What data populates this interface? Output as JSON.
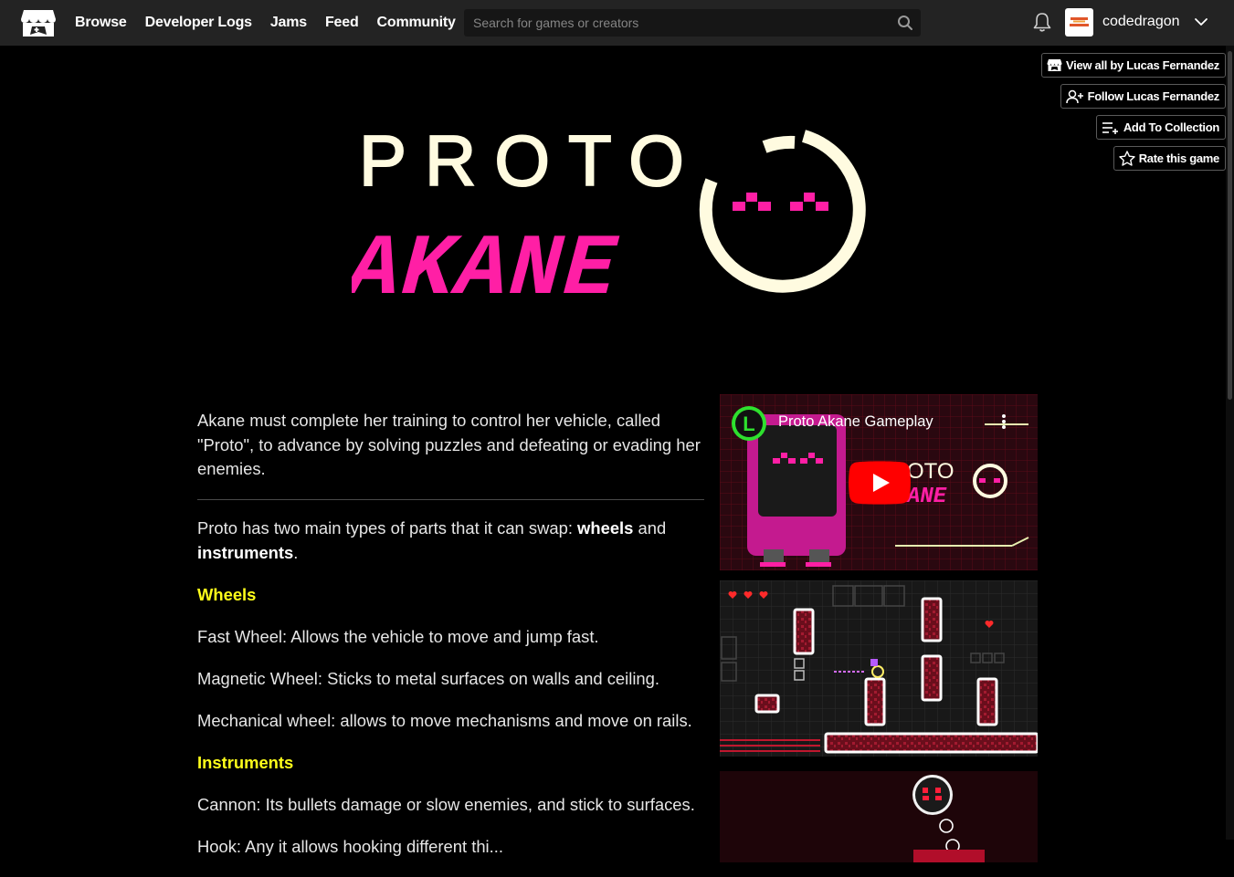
{
  "header": {
    "nav": [
      "Browse",
      "Developer Logs",
      "Jams",
      "Feed",
      "Community"
    ],
    "search_placeholder": "Search for games or creators",
    "username": "codedragon",
    "avatar_text": "code dragon"
  },
  "actions": {
    "view_all": "View all by Lucas Fernandez",
    "follow": "Follow Lucas Fernandez",
    "add_collection": "Add To Collection",
    "rate": "Rate this game"
  },
  "banner": {
    "line1": "PROTO",
    "line2": "AKANE"
  },
  "description": {
    "intro": "Akane must complete her training to control her vehicle, called \"Proto\", to advance by solving puzzles and defeating or evading her enemies.",
    "parts_prefix": "Proto has two main types of parts that it can swap: ",
    "parts_wheels": "wheels",
    "parts_and": " and ",
    "parts_instruments": "instruments",
    "parts_suffix": ".",
    "wheels_heading": "Wheels",
    "fast_wheel": "Fast Wheel: Allows the vehicle to move and jump fast.",
    "magnetic_wheel": "Magnetic Wheel: Sticks to metal surfaces on walls and ceiling.",
    "mechanical_wheel": "Mechanical wheel: allows to move mechanisms and move on rails.",
    "instruments_heading": "Instruments",
    "cannon": "Cannon: Its bullets damage or slow enemies, and stick to surfaces.",
    "hook_partial": "Hook: Any it allows hooking different thi..."
  },
  "video": {
    "title": "Proto Akane Gameplay",
    "channel_letter": "L"
  },
  "colors": {
    "header_bg": "#232323",
    "accent_pink": "#ff1fa5",
    "cream": "#fffbe0",
    "heading_yellow": "#ffff1a"
  }
}
